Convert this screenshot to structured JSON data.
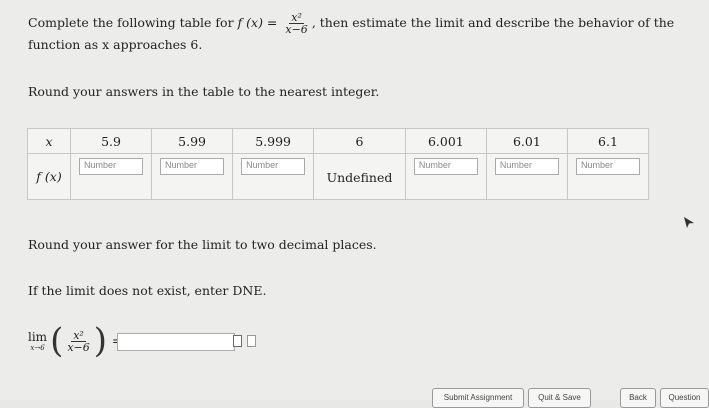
{
  "question": {
    "prompt_start": "Complete the following table for",
    "func_name": "f (x) =",
    "frac_num": "x²",
    "frac_den": "x−6",
    "prompt_end": ", then estimate the limit and describe the behavior of the",
    "prompt_line2": "function as x approaches 6."
  },
  "round_table_instruction": "Round your answers in the table to the nearest integer.",
  "table": {
    "header_label": "x",
    "row_label": "f (x)",
    "x_values": [
      "5.9",
      "5.99",
      "5.999",
      "6",
      "6.001",
      "6.01",
      "6.1"
    ],
    "cells": [
      {
        "placeholder": "Number"
      },
      {
        "placeholder": "Number"
      },
      {
        "placeholder": "Number"
      },
      {
        "text": "Undefined"
      },
      {
        "placeholder": "Number"
      },
      {
        "placeholder": "Number"
      },
      {
        "placeholder": "Number"
      }
    ]
  },
  "round_limit_instruction": "Round your answer for the limit to two decimal places.",
  "dne_instruction": "If the limit does not exist, enter DNE.",
  "limit": {
    "lim": "lim",
    "sub": "x→6",
    "num": "x²",
    "den": "x−6",
    "equals": "=",
    "value": ""
  },
  "buttons": {
    "submit": "Submit Assignment",
    "quit": "Quit & Save",
    "back": "Back",
    "question": "Question"
  }
}
